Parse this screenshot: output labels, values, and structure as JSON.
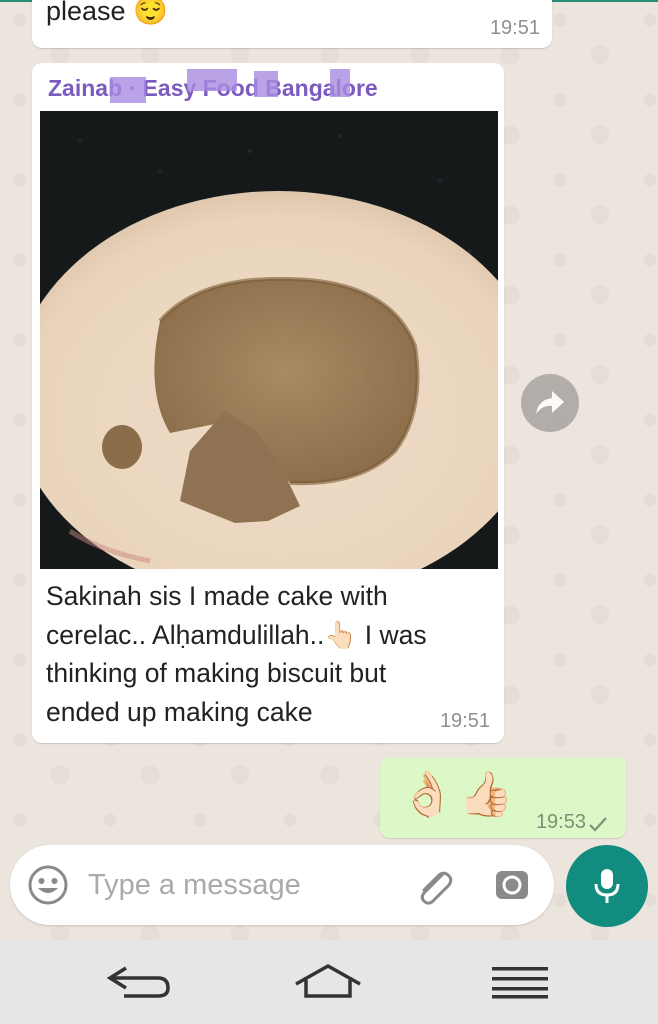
{
  "messages": [
    {
      "text": "please",
      "emoji": "😌",
      "time": "19:51"
    },
    {
      "sender": "Zainab · Easy Food Bangalore",
      "caption_line1": "Sakinah sis I made cake with",
      "caption_line2": "cerelac.. Alḥamdulillah..",
      "caption_emoji": "👆🏻",
      "caption_line2b": " I was",
      "caption_line3": "thinking of making biscuit but",
      "caption_line4": "ended up making cake",
      "time": "19:51"
    },
    {
      "emoji": "👌🏻👍🏻",
      "time": "19:53"
    }
  ],
  "composer": {
    "placeholder": "Type a message"
  },
  "colors": {
    "header_teal": "#128c7e",
    "outgoing_bubble": "#dcf8c6",
    "sender_name": "#7b5bbf"
  }
}
